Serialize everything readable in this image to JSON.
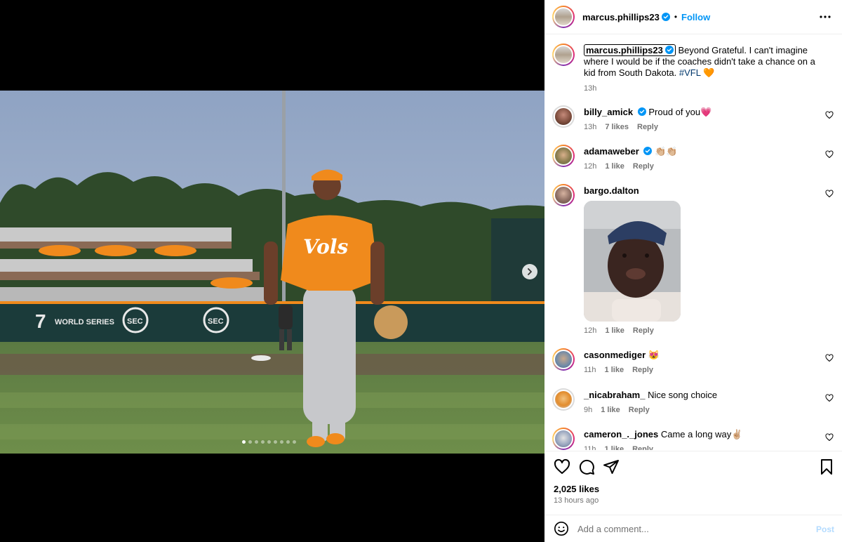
{
  "post": {
    "author": "marcus.phillips23",
    "follow_label": "Follow",
    "separator": "•",
    "caption": {
      "text": "Beyond Grateful. I can't imagine where I would be if the coaches didn't take a chance on a kid from South Dakota.",
      "hashtag": "#VFL",
      "emoji": "🧡",
      "time": "13h"
    },
    "photo": {
      "jersey_text": "Vols",
      "banner_text_1": "WORLD SERIES",
      "banner_text_2": "SEC",
      "slide_count": 9,
      "active_slide": 1
    }
  },
  "comments": [
    {
      "user": "billy_amick",
      "verified": true,
      "text": "Proud of you💗",
      "time": "13h",
      "likes": "7 likes",
      "reply": "Reply"
    },
    {
      "user": "adamaweber",
      "verified": true,
      "text": "👏🏼👏🏼",
      "time": "12h",
      "likes": "1 like",
      "reply": "Reply"
    },
    {
      "user": "bargo.dalton",
      "verified": false,
      "text": "",
      "time": "12h",
      "likes": "1 like",
      "reply": "Reply"
    },
    {
      "user": "casonmediger",
      "verified": false,
      "text": "😻",
      "time": "11h",
      "likes": "1 like",
      "reply": "Reply"
    },
    {
      "user": "_nicabraham_",
      "verified": false,
      "text": "Nice song choice",
      "time": "9h",
      "likes": "1 like",
      "reply": "Reply"
    },
    {
      "user": "cameron_._jones",
      "verified": false,
      "text": "Came a long way✌🏼",
      "time": "11h",
      "likes": "1 like",
      "reply": "Reply"
    }
  ],
  "footer": {
    "likes": "2,025 likes",
    "posted": "13 hours ago",
    "comment_placeholder": "Add a comment...",
    "post_label": "Post"
  },
  "icons": {
    "verified": "verified-badge-icon",
    "like": "heart-icon",
    "comment": "comment-icon",
    "share": "share-icon",
    "save": "bookmark-icon",
    "more": "more-options-icon",
    "emoji": "emoji-icon",
    "next": "chevron-right-icon"
  },
  "colors": {
    "accent": "#0095f6",
    "hashtag": "#00376b",
    "muted": "#737373",
    "jersey": "#f08a1c"
  }
}
